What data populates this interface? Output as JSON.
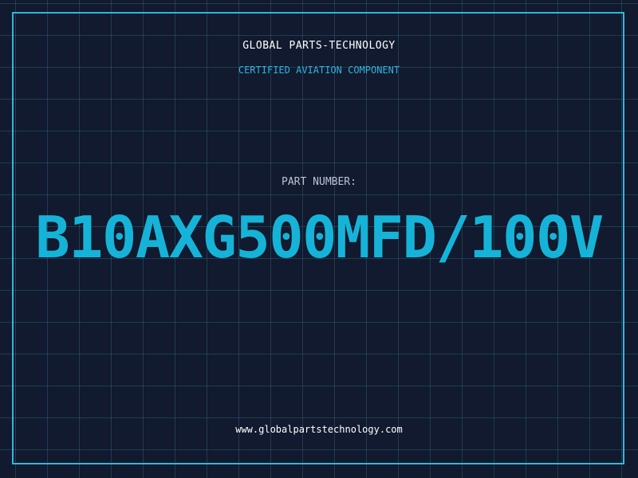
{
  "header": {
    "company_name": "GLOBAL PARTS-TECHNOLOGY",
    "certification": "CERTIFIED AVIATION COMPONENT"
  },
  "part": {
    "label": "PART NUMBER:",
    "number": "B10AXG500MFD/100V"
  },
  "footer": {
    "website": "www.globalpartstechnology.com"
  },
  "colors": {
    "background": "#111a2e",
    "grid": "#2f6f88",
    "accent": "#16b3d8",
    "frame": "#2bb8dc",
    "text_primary": "#ffffff",
    "text_muted": "#b9c4d3"
  }
}
